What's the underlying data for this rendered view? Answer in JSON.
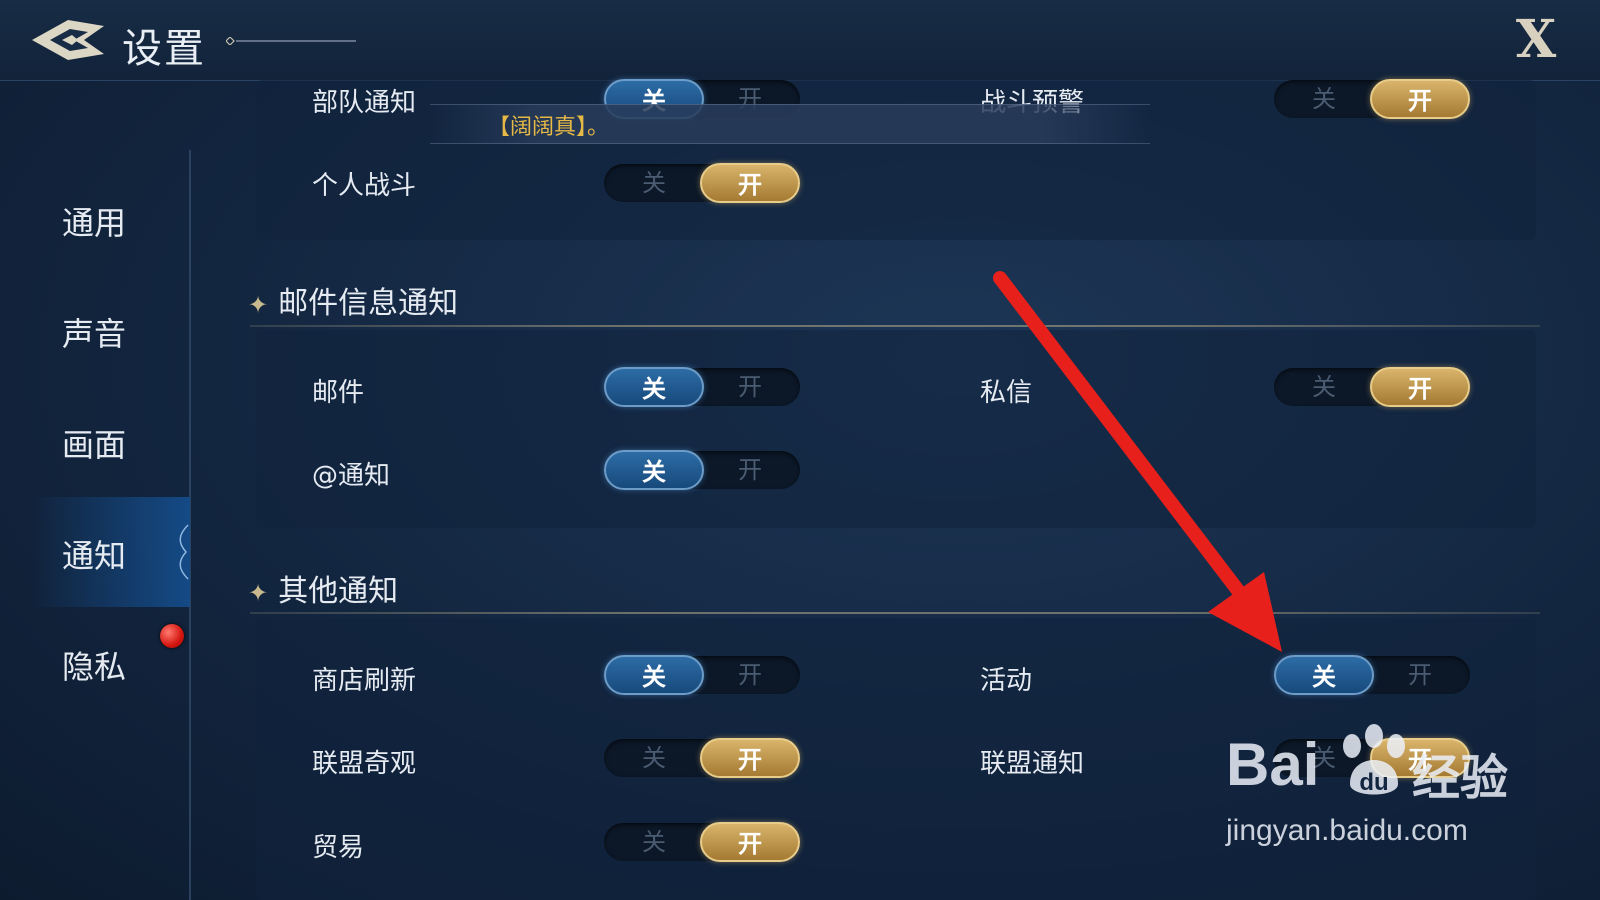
{
  "header": {
    "title": "设置",
    "close_label": "X"
  },
  "sidebar": {
    "items": [
      {
        "label": "通用"
      },
      {
        "label": "声音"
      },
      {
        "label": "画面"
      },
      {
        "label": "通知",
        "active": true
      },
      {
        "label": "隐私"
      }
    ]
  },
  "tooltip": {
    "text": "【阔阔真】。"
  },
  "toggle_labels": {
    "off": "关",
    "on": "开"
  },
  "sections": {
    "top": {
      "rows": [
        {
          "label": "部队通知",
          "state": "off"
        },
        {
          "label": "战斗预警",
          "state": "on"
        },
        {
          "label": "个人战斗",
          "state": "on"
        }
      ]
    },
    "mail": {
      "title": "邮件信息通知",
      "rows": [
        {
          "label": "邮件",
          "state": "off"
        },
        {
          "label": "私信",
          "state": "on"
        },
        {
          "label": "@通知",
          "state": "off"
        }
      ]
    },
    "other": {
      "title": "其他通知",
      "rows": [
        {
          "label": "商店刷新",
          "state": "off"
        },
        {
          "label": "活动",
          "state": "off"
        },
        {
          "label": "联盟奇观",
          "state": "on"
        },
        {
          "label": "联盟通知",
          "state": "on"
        },
        {
          "label": "贸易",
          "state": "on"
        }
      ]
    }
  },
  "watermark": {
    "logo": "Bai",
    "cn": "经验",
    "url": "jingyan.baidu.com"
  },
  "colors": {
    "accent_blue": "#2d6ca6",
    "accent_gold": "#d9b46a",
    "arrow": "#e8201c"
  }
}
